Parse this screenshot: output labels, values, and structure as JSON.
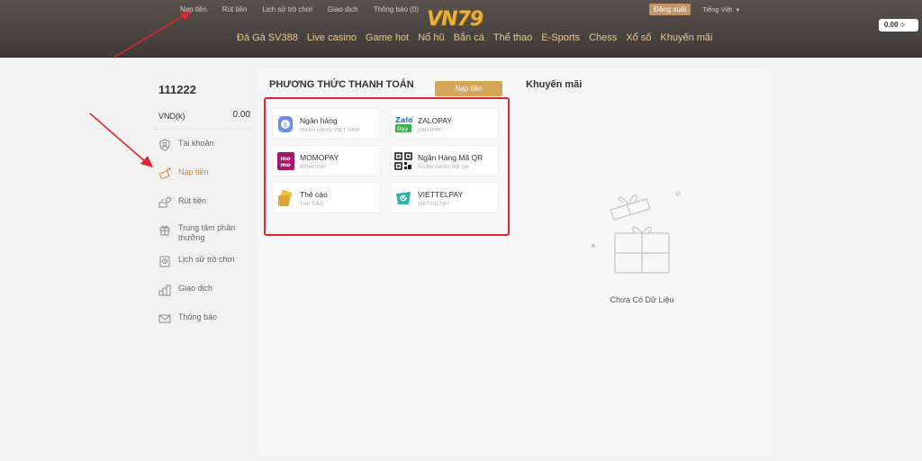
{
  "header": {
    "top_links": [
      "Nạp tiền",
      "Rút tiền",
      "Lịch sử trò chơi",
      "Giao dịch",
      "Thông báo (0)"
    ],
    "logo": "VN79",
    "logout_label": "Đăng xuất",
    "language": "Tiếng Việt",
    "nav": [
      "Đá Gà SV388",
      "Live casino",
      "Game hot",
      "Nổ hũ",
      "Bắn cá",
      "Thể thao",
      "E-Sports",
      "Chess",
      "Xổ số",
      "Khuyến mãi"
    ],
    "balance": "0.00"
  },
  "sidebar": {
    "username": "111222",
    "currency": "VND(k)",
    "amount": "0.00",
    "items": [
      {
        "label": "Tài khoản",
        "icon": "account-icon"
      },
      {
        "label": "Nạp tiền",
        "icon": "deposit-icon",
        "active": true
      },
      {
        "label": "Rút tiền",
        "icon": "withdraw-icon"
      },
      {
        "label": "Trung tâm phần thưởng",
        "icon": "gift-icon"
      },
      {
        "label": "Lịch sử trò chơi",
        "icon": "history-icon"
      },
      {
        "label": "Giao dịch",
        "icon": "transaction-icon"
      },
      {
        "label": "Thông báo",
        "icon": "mail-icon"
      }
    ]
  },
  "payment": {
    "title": "PHƯƠNG THỨC THANH TOÁN",
    "deposit_button": "Nạp tiền",
    "methods": [
      {
        "name": "Ngân hàng",
        "sub": "NGÂN HÀNG VIỆT NAM",
        "icon": "bank-icon"
      },
      {
        "name": "ZALOPAY",
        "sub": "ZALOPAY",
        "icon": "zalopay-icon"
      },
      {
        "name": "MOMOPAY",
        "sub": "MOMOPAY",
        "icon": "momo-icon"
      },
      {
        "name": "Ngân Hàng Mã QR",
        "sub": "NGÂN HÀNG MÃ QR",
        "icon": "qr-icon"
      },
      {
        "name": "Thẻ cào",
        "sub": "THẺ CÀO",
        "icon": "card-icon"
      },
      {
        "name": "VIETTELPAY",
        "sub": "VIETTELPAY",
        "icon": "viettelpay-icon"
      }
    ]
  },
  "promotion": {
    "title": "Khuyến mãi",
    "empty_text": "Chưa Có Dữ Liệu"
  },
  "colors": {
    "accent": "#d4a758",
    "highlight": "#e0262e",
    "active_menu": "#c98a3d"
  }
}
